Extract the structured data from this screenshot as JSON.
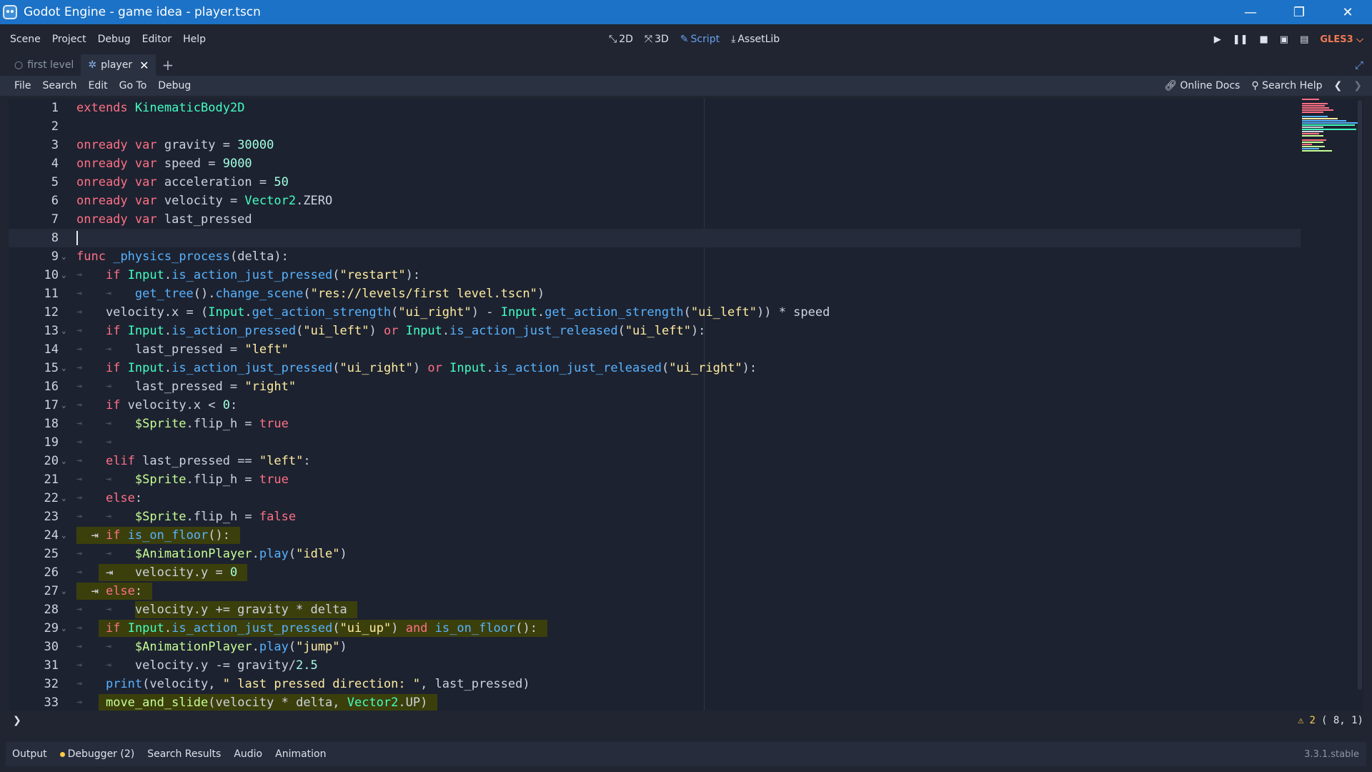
{
  "window": {
    "title": "Godot Engine - game idea - player.tscn",
    "controls": [
      "minimize-icon",
      "restore-icon",
      "close-icon"
    ]
  },
  "menu": {
    "items": [
      "Scene",
      "Project",
      "Debug",
      "Editor",
      "Help"
    ],
    "main_tabs": [
      "2D",
      "3D",
      "Script",
      "AssetLib"
    ],
    "active_tab": "Script",
    "renderer": "GLES3 ⌵"
  },
  "scene_tabs": [
    {
      "label": "first level",
      "active": false
    },
    {
      "label": "player",
      "active": true
    }
  ],
  "script_menu": {
    "items": [
      "File",
      "Search",
      "Edit",
      "Go To",
      "Debug"
    ],
    "online_docs": "Online Docs",
    "search_help": "Search Help"
  },
  "code_lines": [
    "1",
    "2",
    "3",
    "4",
    "5",
    "6",
    "7",
    "8",
    "9",
    "10",
    "11",
    "12",
    "13",
    "14",
    "15",
    "16",
    "17",
    "18",
    "19",
    "20",
    "21",
    "22",
    "23",
    "24",
    "25",
    "26",
    "27",
    "28",
    "29",
    "30",
    "31",
    "32",
    "33"
  ],
  "status": {
    "prompt": "❯",
    "warnings": "2",
    "position": "(   8,  1)"
  },
  "bottom_tabs": [
    "Output",
    "Debugger (2)",
    "Search Results",
    "Audio",
    "Animation"
  ],
  "version": "3.3.1.stable",
  "colors": {
    "titlebar": "#1c72c6",
    "accent": "#6aa0f0",
    "keyword": "#ff7085",
    "string": "#ffeda1",
    "number": "#a1ffe0",
    "type": "#42ffc2",
    "function": "#57b3ff",
    "highlight": "#3b3f0c"
  }
}
